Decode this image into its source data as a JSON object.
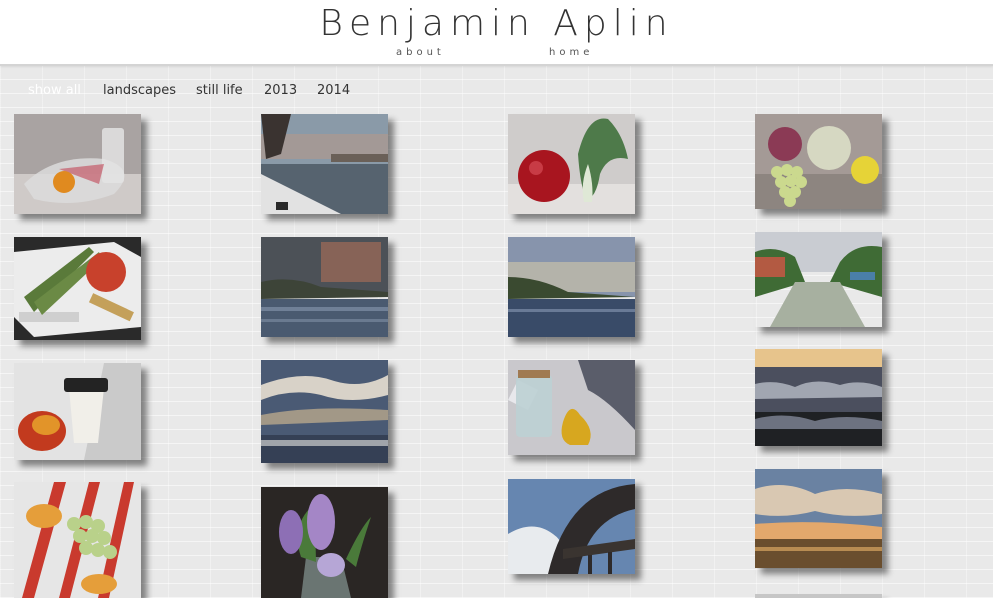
{
  "header": {
    "title": "Benjamin Aplin",
    "nav": {
      "about": "about",
      "home": "home"
    }
  },
  "filters": {
    "items": [
      "show all",
      "landscapes",
      "still life",
      "2013",
      "2014"
    ],
    "active": "show all"
  },
  "gallery": {
    "items": [
      {
        "subject": "glass-dish-orange-still-life"
      },
      {
        "subject": "lakeside-promenade-landscape"
      },
      {
        "subject": "pomegranate-bok-choy-still-life"
      },
      {
        "subject": "cabbage-artichoke-grapes-still-life"
      },
      {
        "subject": "asparagus-apple-still-life"
      },
      {
        "subject": "sunset-lake-hills-landscape"
      },
      {
        "subject": "blue-lake-hills-landscape"
      },
      {
        "subject": "canal-trees-landscape"
      },
      {
        "subject": "mango-coffee-cup-still-life"
      },
      {
        "subject": "cloudy-harbor-landscape"
      },
      {
        "subject": "glass-jar-pear-still-life"
      },
      {
        "subject": "stormy-waves-landscape"
      },
      {
        "subject": "striped-cloth-grapes-still-life"
      },
      {
        "subject": "hyacinth-vase-still-life"
      },
      {
        "subject": "bridge-arch-landscape"
      },
      {
        "subject": "cloudy-sunset-field-landscape"
      }
    ]
  }
}
